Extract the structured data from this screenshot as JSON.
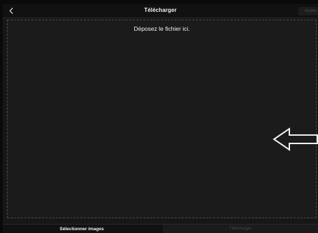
{
  "header": {
    "title": "Télécharger",
    "back_icon": "chevron-left-icon",
    "modify_label": "Modifier"
  },
  "dropzone": {
    "text": "Déposez le fichier ici.",
    "arrow_icon": "arrow-left-icon"
  },
  "footer": {
    "select_label": "Sélectionner images",
    "upload_label": "Télécharger"
  },
  "colors": {
    "background": "#171717",
    "bar": "#111111",
    "text": "#f2f2f2",
    "disabled_text": "#474747",
    "dropzone_border": "#4a4a4a"
  }
}
